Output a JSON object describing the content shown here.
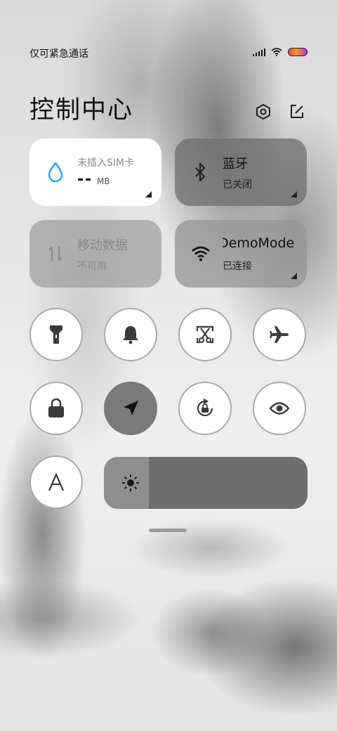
{
  "status": {
    "carrier_text": "仅可紧急通话",
    "battery_gradient_colors": [
      "#ff3c3c",
      "#ff9a1e",
      "#a335ff"
    ]
  },
  "header": {
    "title": "控制中心",
    "settings_icon": "hexagon-settings-icon",
    "edit_icon": "edit-icon"
  },
  "tiles": {
    "sim": {
      "label": "未插入SIM卡",
      "value": "--",
      "unit": "MB",
      "icon": "water-drop-icon",
      "accent": "#2aa3ef"
    },
    "bluetooth": {
      "label": "蓝牙",
      "status": "已关闭",
      "icon": "bluetooth-icon"
    },
    "mobile_data": {
      "label": "移动数据",
      "status": "不可用",
      "icon": "data-arrows-icon"
    },
    "wifi": {
      "label": "DemoMode",
      "status": "已连接",
      "icon": "wifi-icon"
    }
  },
  "toggles": [
    {
      "name": "flashlight",
      "icon": "flashlight-icon",
      "active": false
    },
    {
      "name": "ringer",
      "icon": "bell-icon",
      "active": false
    },
    {
      "name": "screenshot",
      "icon": "scissors-screenshot-icon",
      "active": false
    },
    {
      "name": "airplane",
      "icon": "airplane-icon",
      "active": false
    },
    {
      "name": "lock-screen",
      "icon": "lock-icon",
      "active": false
    },
    {
      "name": "location",
      "icon": "location-arrow-icon",
      "active": true
    },
    {
      "name": "auto-rotate",
      "icon": "rotate-lock-icon",
      "active": false
    },
    {
      "name": "reading-mode",
      "icon": "eye-icon",
      "active": false
    },
    {
      "name": "auto-brightness",
      "icon": "letter-a-icon",
      "active": false
    }
  ],
  "brightness": {
    "level": 0.22,
    "icon": "sun-icon"
  }
}
